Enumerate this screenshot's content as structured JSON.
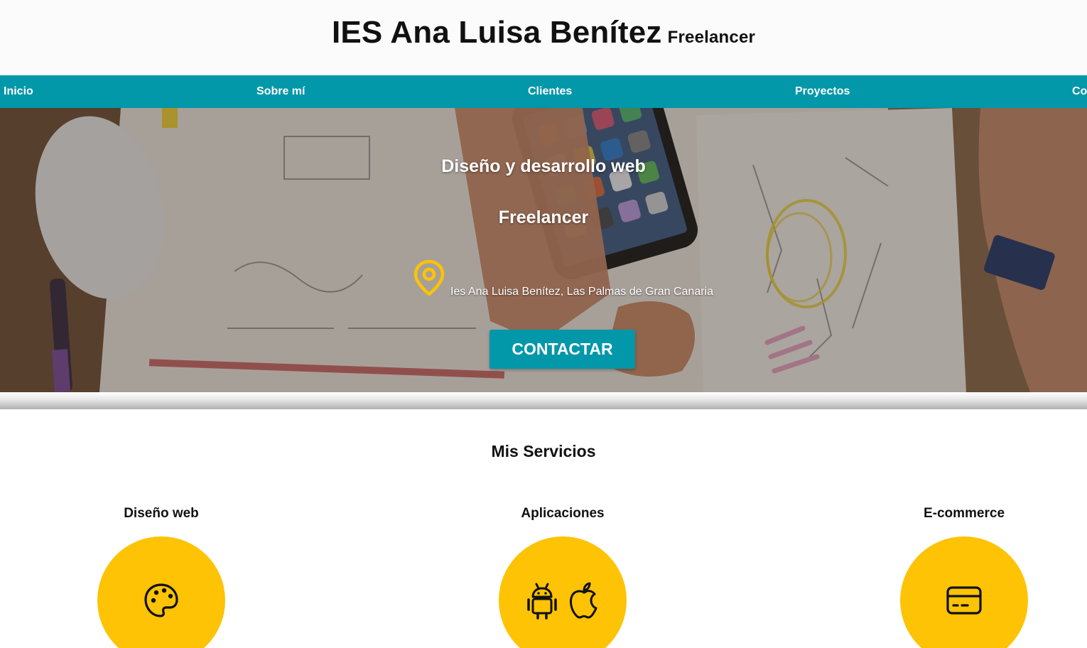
{
  "header": {
    "title": "IES Ana Luisa Benítez",
    "subtitle": "Freelancer"
  },
  "nav": {
    "items": [
      {
        "label": "Inicio"
      },
      {
        "label": "Sobre mí"
      },
      {
        "label": "Clientes"
      },
      {
        "label": "Proyectos"
      },
      {
        "label": "Contacto"
      }
    ]
  },
  "hero": {
    "title": "Diseño y desarrollo web",
    "subtitle": "Freelancer",
    "location": "Ies Ana Luisa Benítez, Las Palmas de Gran Canaria",
    "location_icon": "map-pin-icon",
    "cta_label": "CONTACTAR"
  },
  "services": {
    "title": "Mis Servicios",
    "items": [
      {
        "name": "Diseño web",
        "icons": [
          "palette-icon"
        ]
      },
      {
        "name": "Aplicaciones",
        "icons": [
          "android-icon",
          "apple-icon"
        ]
      },
      {
        "name": "E-commerce",
        "icons": [
          "credit-card-icon"
        ]
      }
    ]
  },
  "colors": {
    "accent": "#0297a9",
    "highlight": "#fdc304",
    "text": "#111111",
    "header_bg": "#fbfbfb"
  }
}
